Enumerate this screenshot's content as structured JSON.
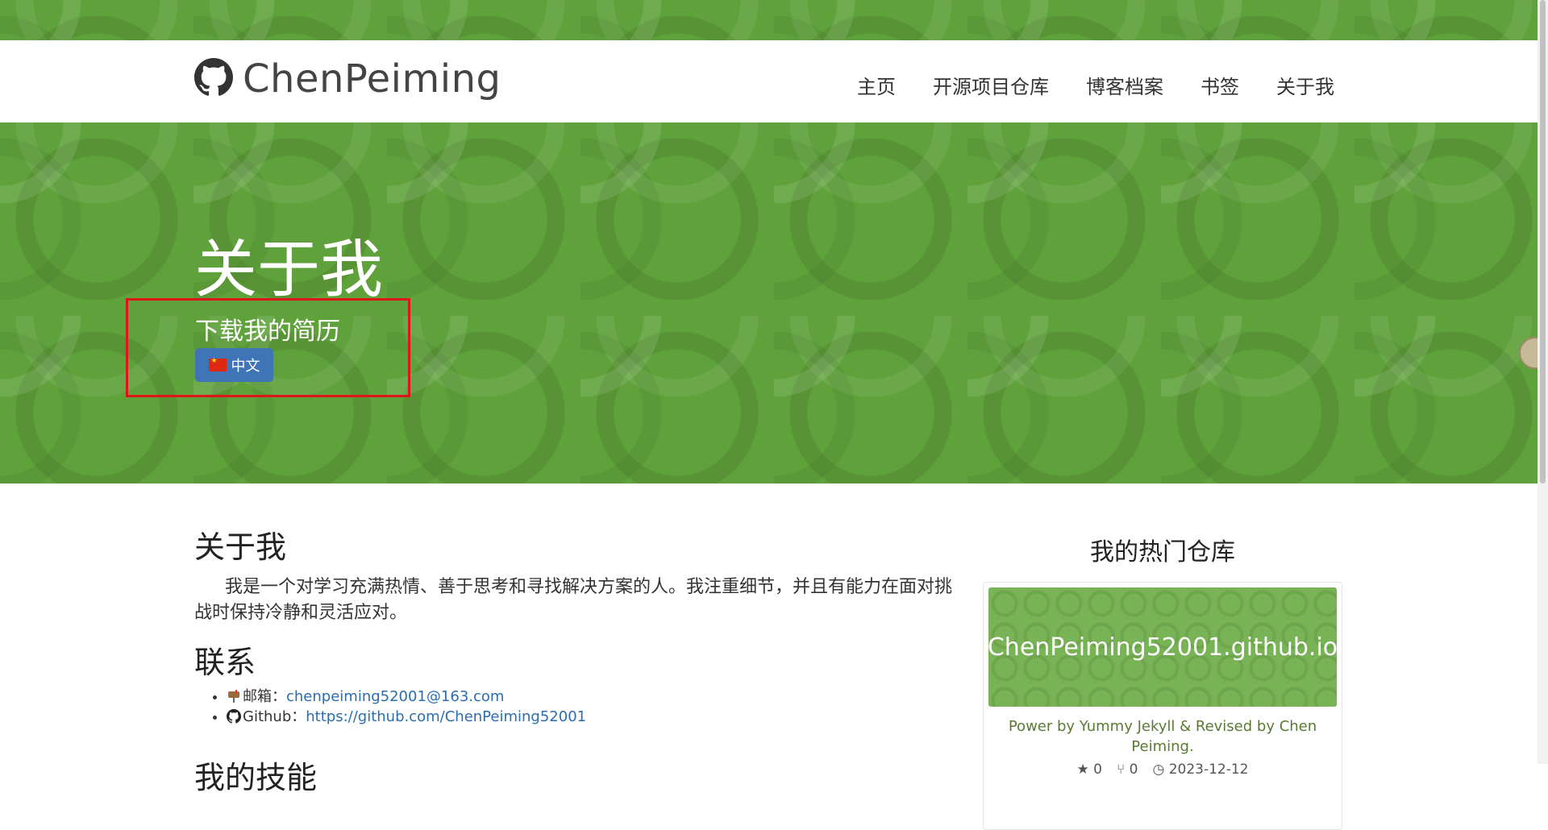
{
  "brand": {
    "name": "ChenPeiming",
    "icon": "github-icon"
  },
  "nav": [
    "主页",
    "开源项目仓库",
    "博客档案",
    "书签",
    "关于我"
  ],
  "hero": {
    "title": "关于我",
    "subtitle": "下载我的简历",
    "lang_button": "中文",
    "flag_icon": "china-flag-icon"
  },
  "about": {
    "heading": "关于我",
    "text": "我是一个对学习充满热情、善于思考和寻找解决方案的人。我注重细节，并且有能力在面对挑战时保持冷静和灵活应对。"
  },
  "contact": {
    "heading": "联系",
    "items": [
      {
        "icon": "mailbox-icon",
        "label": "邮箱：",
        "value": "chenpeiming52001@163.com"
      },
      {
        "icon": "github-icon",
        "label": "Github：",
        "value": "https://github.com/ChenPeiming52001"
      }
    ]
  },
  "skills_heading": "我的技能",
  "sidebar": {
    "title": "我的热门仓库",
    "repo": {
      "name": "ChenPeiming52001.github.io",
      "description": "Power by Yummy Jekyll & Revised by Chen Peiming.",
      "stars": "0",
      "forks": "0",
      "date": "2023-12-12"
    }
  },
  "colors": {
    "hero_green": "#5fa13b",
    "button_blue": "#3f75b6",
    "highlight_red": "#e0141b",
    "link_blue": "#2a6db0"
  }
}
